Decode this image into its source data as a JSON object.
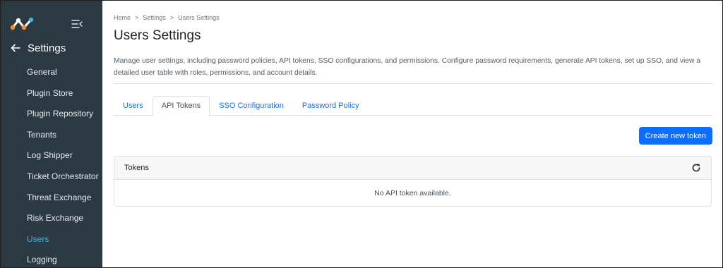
{
  "sidebar": {
    "back_label": "Settings",
    "items": [
      {
        "label": "General",
        "active": false
      },
      {
        "label": "Plugin Store",
        "active": false
      },
      {
        "label": "Plugin Repository",
        "active": false
      },
      {
        "label": "Tenants",
        "active": false
      },
      {
        "label": "Log Shipper",
        "active": false
      },
      {
        "label": "Ticket Orchestrator",
        "active": false
      },
      {
        "label": "Threat Exchange",
        "active": false
      },
      {
        "label": "Risk Exchange",
        "active": false
      },
      {
        "label": "Users",
        "active": true
      },
      {
        "label": "Logging",
        "active": false
      }
    ],
    "colors": {
      "background": "#2b3a42",
      "active": "#35b5ea"
    }
  },
  "breadcrumb": [
    "Home",
    "Settings",
    "Users Settings"
  ],
  "breadcrumb_separator": ">",
  "page": {
    "title": "Users Settings",
    "description": "Manage user settings, including password policies, API tokens, SSO configurations, and permissions. Configure password requirements, generate API tokens, set up SSO, and view a detailed user table with roles, permissions, and account details."
  },
  "tabs": [
    {
      "label": "Users",
      "active": false
    },
    {
      "label": "API Tokens",
      "active": true
    },
    {
      "label": "SSO Configuration",
      "active": false
    },
    {
      "label": "Password Policy",
      "active": false
    }
  ],
  "actions": {
    "create_token_label": "Create new token"
  },
  "tokens_card": {
    "title": "Tokens",
    "empty_message": "No API token available.",
    "refresh_icon": "refresh-icon"
  },
  "accent_color": "#0d6efd"
}
